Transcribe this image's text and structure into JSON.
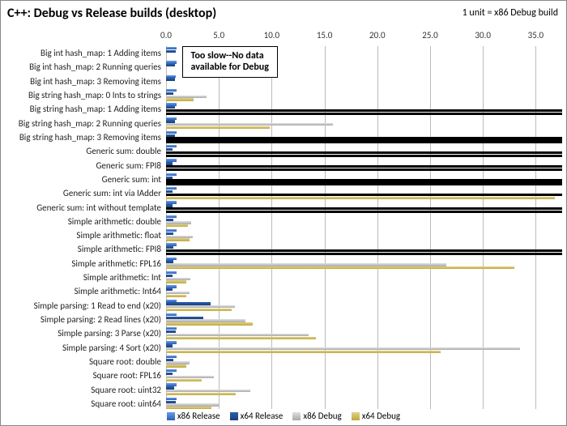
{
  "title": "C++: Debug vs Release builds (desktop)",
  "subtitle": "1 unit = x86 Debug build",
  "too_slow_label": "Too slow--No data\navailable for Debug",
  "legend_labels": [
    "x86 Release",
    "x64 Release",
    "x86 Debug",
    "x64 Debug"
  ],
  "chart_data": {
    "type": "bar",
    "orientation": "horizontal",
    "xlabel": "",
    "ylabel": "",
    "xlim": [
      0,
      37.5
    ],
    "ticks": [
      0,
      5,
      10,
      15,
      20,
      25,
      30,
      35
    ],
    "categories": [
      "Big int hash_map: 1 Adding items",
      "Big int hash_map: 2 Running queries",
      "Big int hash_map: 3 Removing items",
      "Big string hash_map: 0 Ints to strings",
      "Big string hash_map: 1 Adding items",
      "Big string hash_map: 2 Running queries",
      "Big string hash_map: 3 Removing items",
      "Generic sum: double",
      "Generic sum: FPI8",
      "Generic sum: int",
      "Generic sum: int via IAdder",
      "Generic sum: int without template",
      "Simple arithmetic: double",
      "Simple arithmetic: float",
      "Simple arithmetic: FPI8",
      "Simple arithmetic: FPL16",
      "Simple arithmetic: Int",
      "Simple arithmetic: Int64",
      "Simple parsing: 1 Read to end (x20)",
      "Simple parsing: 2 Read lines (x20)",
      "Simple parsing: 3 Parse (x20)",
      "Simple parsing: 4 Sort (x20)",
      "Square root: double",
      "Square root: FPL16",
      "Square root: uint32",
      "Square root: uint64"
    ],
    "series": [
      {
        "name": "x86 Release",
        "color": "#3d71c7",
        "values": [
          1.0,
          1.0,
          0.95,
          1.0,
          1.0,
          1.0,
          1.0,
          1.0,
          1.0,
          1.0,
          1.0,
          1.0,
          1.0,
          1.0,
          1.0,
          1.0,
          1.0,
          1.0,
          1.0,
          1.0,
          1.0,
          1.0,
          1.0,
          1.0,
          1.0,
          1.0
        ]
      },
      {
        "name": "x64 Release",
        "color": "#234d92",
        "values": [
          0.9,
          0.85,
          0.85,
          0.7,
          0.85,
          0.85,
          0.85,
          0.6,
          0.6,
          0.6,
          0.6,
          0.6,
          0.7,
          0.7,
          0.7,
          0.7,
          0.6,
          0.65,
          4.2,
          3.5,
          0.9,
          0.65,
          0.7,
          0.6,
          0.8,
          0.95
        ]
      },
      {
        "name": "x86 Debug",
        "color": "#bfbfbf",
        "values": [
          null,
          null,
          null,
          3.8,
          99,
          15.8,
          99,
          99,
          99,
          99,
          99,
          99,
          2.4,
          2.5,
          99,
          26.5,
          2.3,
          2.2,
          6.5,
          7.5,
          13.5,
          33.5,
          2.2,
          4.5,
          8.0,
          5.0
        ],
        "overflow": [
          false,
          false,
          false,
          false,
          true,
          false,
          true,
          true,
          true,
          true,
          true,
          true,
          false,
          false,
          true,
          false,
          false,
          false,
          false,
          false,
          false,
          false,
          false,
          false,
          false,
          false
        ]
      },
      {
        "name": "x64 Debug",
        "color": "#c0ac3f",
        "values": [
          null,
          null,
          null,
          2.6,
          99,
          9.8,
          99,
          99,
          99,
          99,
          36.8,
          99,
          2.1,
          2.2,
          99,
          33.0,
          1.9,
          1.9,
          6.2,
          8.2,
          14.2,
          26.0,
          1.9,
          3.4,
          6.6,
          4.3
        ],
        "overflow": [
          false,
          false,
          false,
          false,
          true,
          false,
          true,
          true,
          true,
          true,
          false,
          true,
          false,
          false,
          true,
          false,
          false,
          false,
          false,
          false,
          false,
          false,
          false,
          false,
          false,
          false
        ]
      }
    ]
  }
}
